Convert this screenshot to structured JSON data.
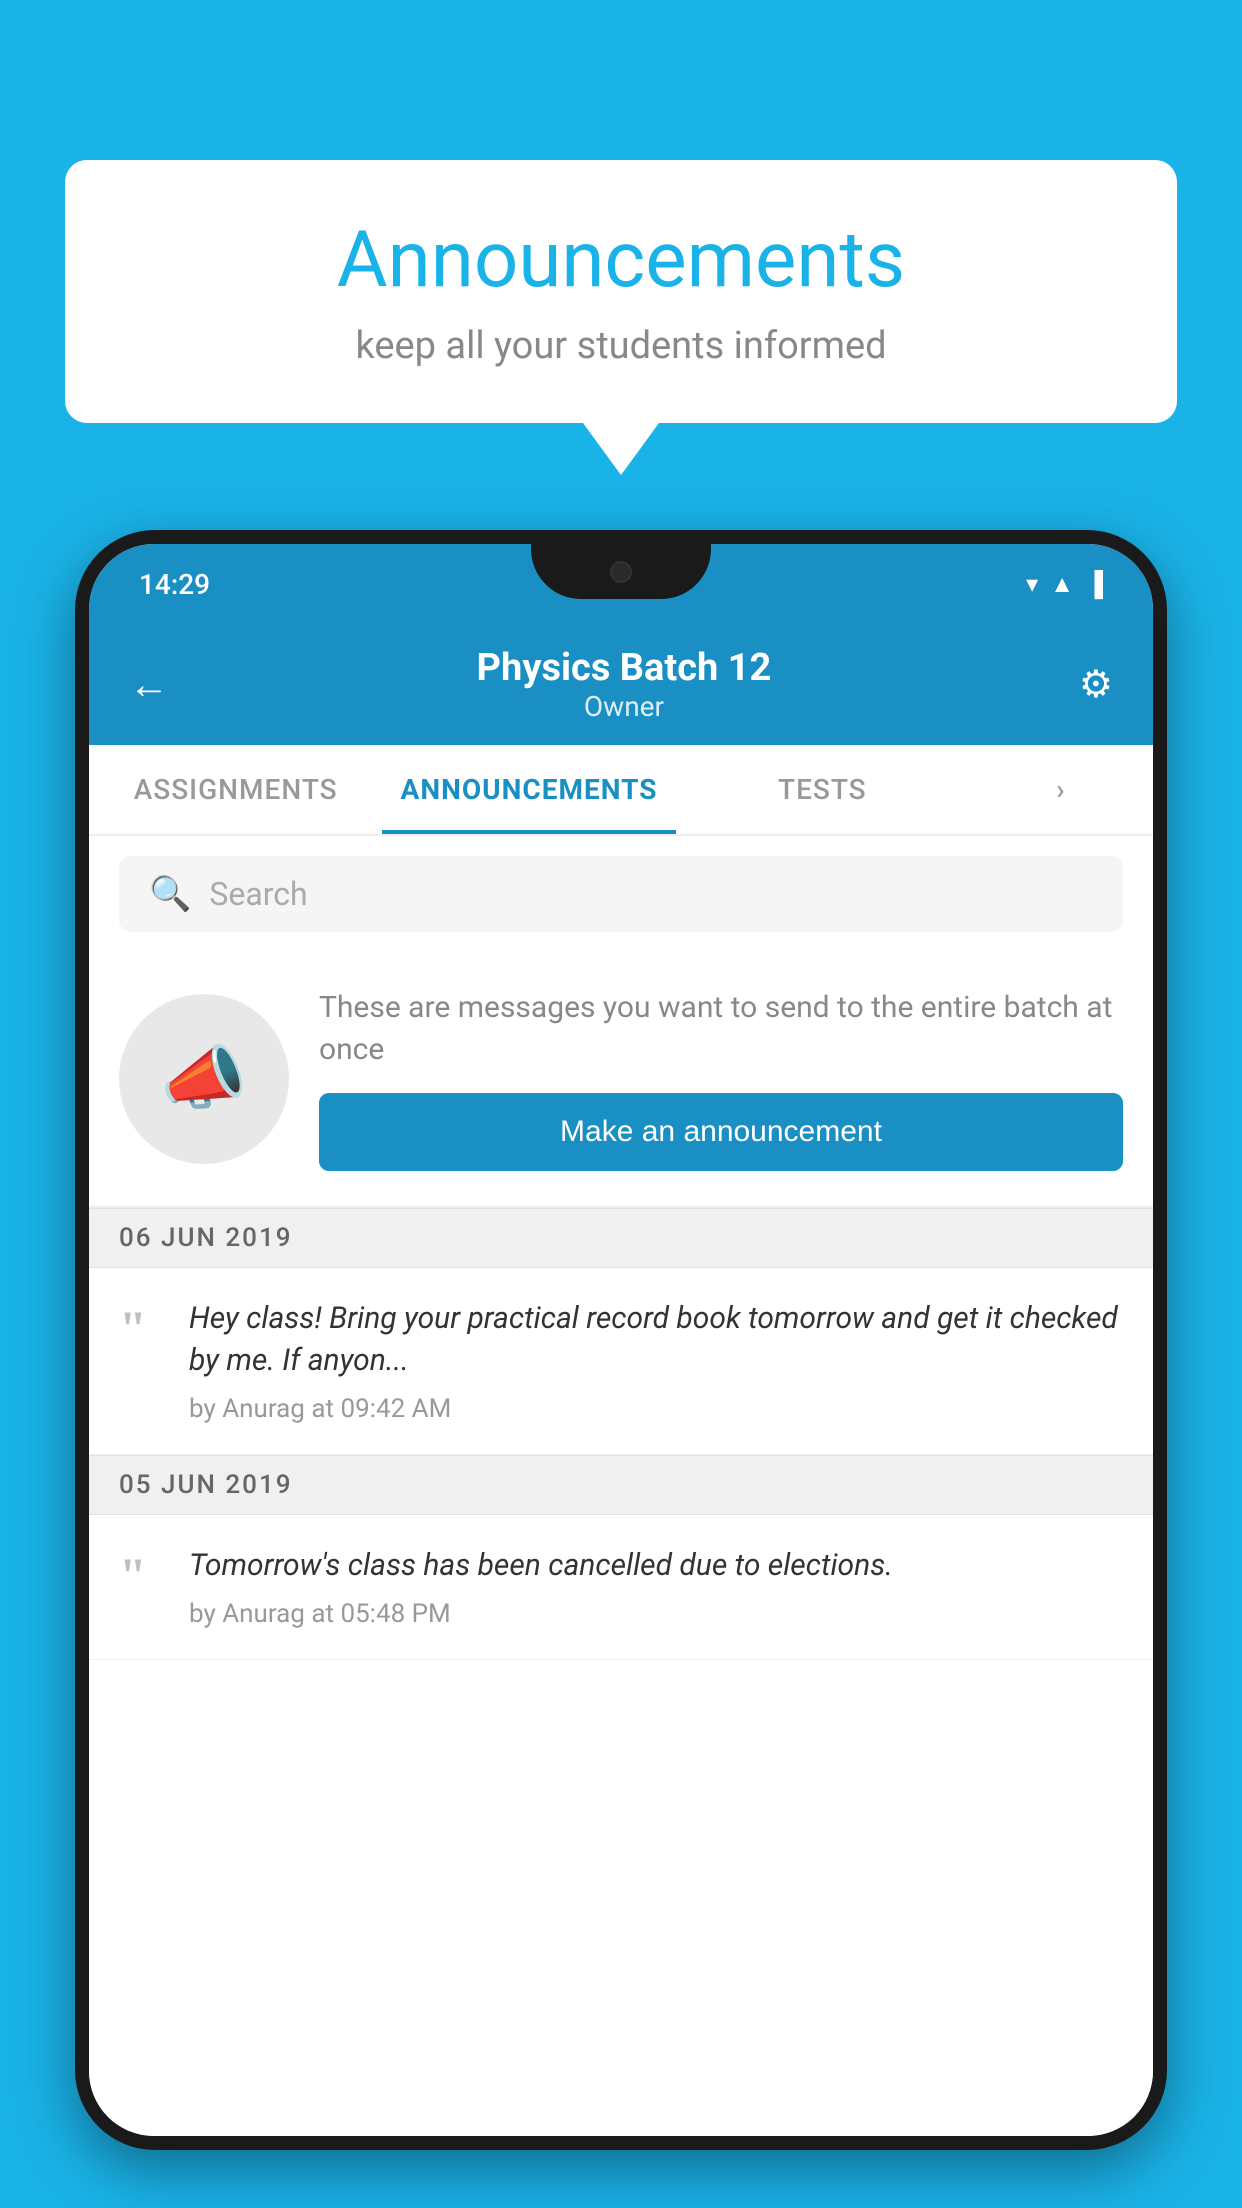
{
  "background_color": "#1ab3e8",
  "speech_bubble": {
    "title": "Announcements",
    "subtitle": "keep all your students informed"
  },
  "phone": {
    "status_bar": {
      "time": "14:29",
      "icons": [
        "wifi",
        "signal",
        "battery"
      ]
    },
    "header": {
      "back_label": "←",
      "title": "Physics Batch 12",
      "subtitle": "Owner",
      "gear_label": "⚙"
    },
    "tabs": [
      {
        "label": "ASSIGNMENTS",
        "active": false
      },
      {
        "label": "ANNOUNCEMENTS",
        "active": true
      },
      {
        "label": "TESTS",
        "active": false
      },
      {
        "label": "›",
        "active": false,
        "partial": true
      }
    ],
    "search": {
      "placeholder": "Search"
    },
    "promo": {
      "description": "These are messages you want to send to the entire batch at once",
      "button_label": "Make an announcement"
    },
    "announcements": [
      {
        "date": "06  JUN  2019",
        "text": "Hey class! Bring your practical record book tomorrow and get it checked by me. If anyon...",
        "meta": "by Anurag at 09:42 AM"
      },
      {
        "date": "05  JUN  2019",
        "text": "Tomorrow's class has been cancelled due to elections.",
        "meta": "by Anurag at 05:48 PM"
      }
    ]
  }
}
